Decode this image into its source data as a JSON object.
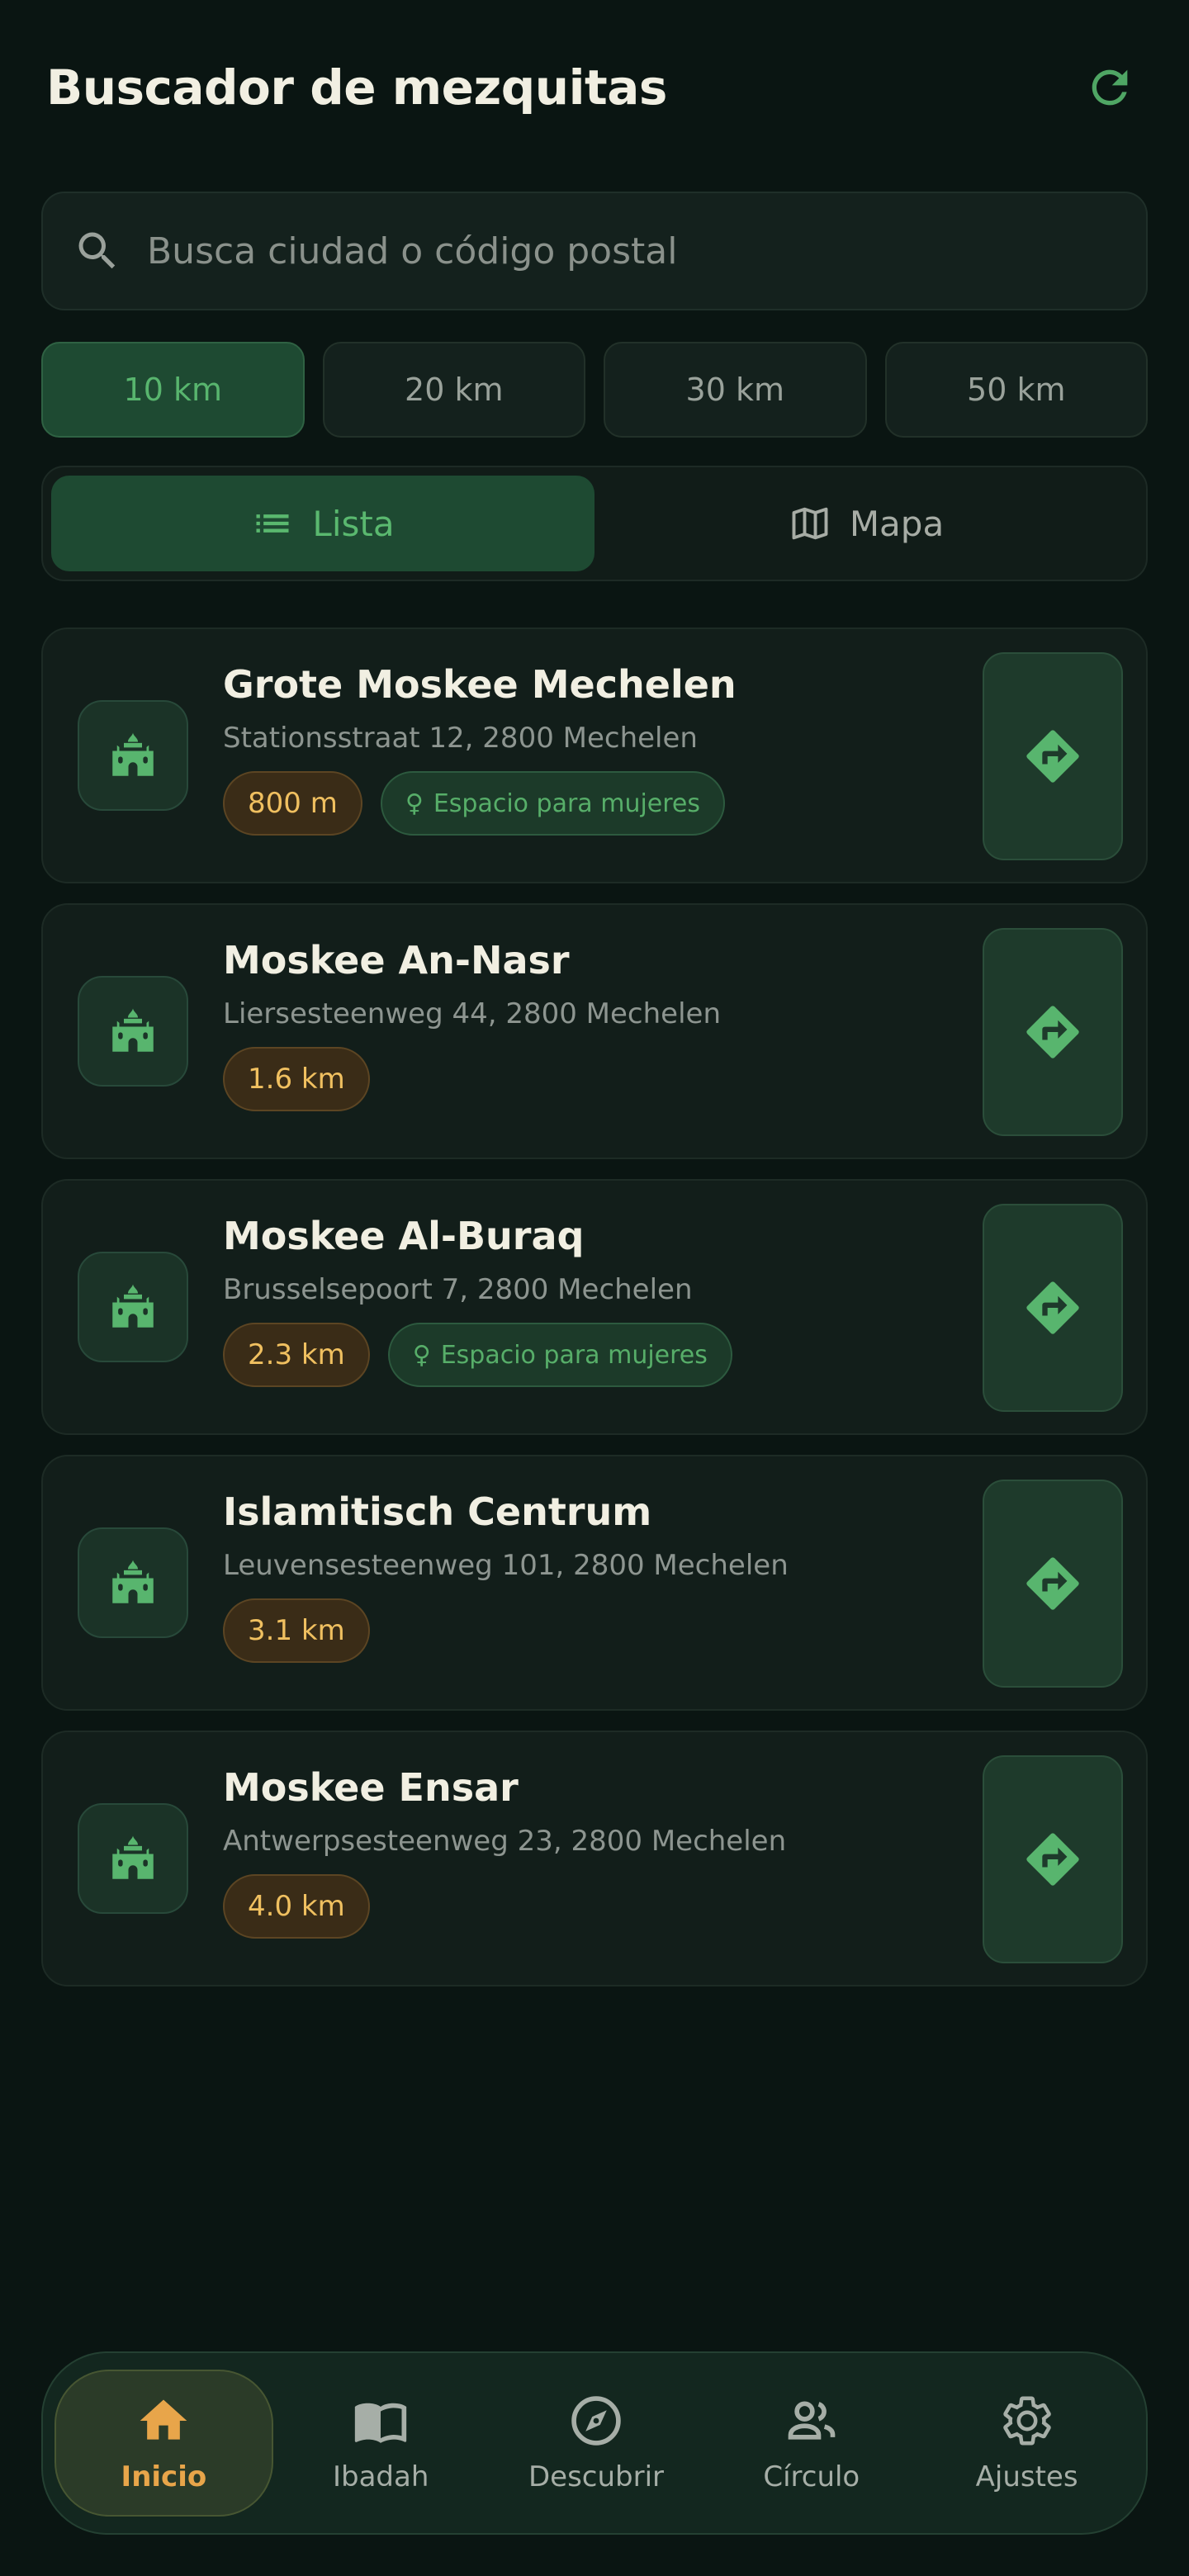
{
  "header": {
    "title": "Buscador de mezquitas",
    "refresh_icon": "refresh-icon"
  },
  "search": {
    "placeholder": "Busca ciudad o código postal",
    "icon": "search-icon"
  },
  "radius": {
    "options": [
      "10 km",
      "20 km",
      "30 km",
      "50 km"
    ],
    "selected": "10 km"
  },
  "view_toggle": {
    "list_label": "Lista",
    "map_label": "Mapa",
    "selected": "Lista"
  },
  "mosques": [
    {
      "name": "Grote Moskee Mechelen",
      "address": "Stationsstraat 12, 2800 Mechelen",
      "distance": "800 m",
      "women_space": "Espacio para mujeres"
    },
    {
      "name": "Moskee An-Nasr",
      "address": "Liersesteenweg 44, 2800 Mechelen",
      "distance": "1.6 km",
      "women_space": ""
    },
    {
      "name": "Moskee Al-Buraq",
      "address": "Brusselsepoort 7, 2800 Mechelen",
      "distance": "2.3 km",
      "women_space": "Espacio para mujeres"
    },
    {
      "name": "Islamitisch Centrum",
      "address": "Leuvensesteenweg 101, 2800 Mechelen",
      "distance": "3.1 km",
      "women_space": ""
    },
    {
      "name": "Moskee Ensar",
      "address": "Antwerpsesteenweg 23, 2800 Mechelen",
      "distance": "4.0 km",
      "women_space": ""
    }
  ],
  "nav": {
    "items": [
      {
        "label": "Inicio",
        "icon": "home-icon"
      },
      {
        "label": "Ibadah",
        "icon": "book-icon"
      },
      {
        "label": "Descubrir",
        "icon": "compass-icon"
      },
      {
        "label": "Círculo",
        "icon": "people-icon"
      },
      {
        "label": "Ajustes",
        "icon": "gear-icon"
      }
    ],
    "active": "Inicio"
  },
  "colors": {
    "background": "#0a1512",
    "accent_green": "#58b56e",
    "accent_orange": "#e8a54a",
    "distance_text": "#f0c060"
  }
}
